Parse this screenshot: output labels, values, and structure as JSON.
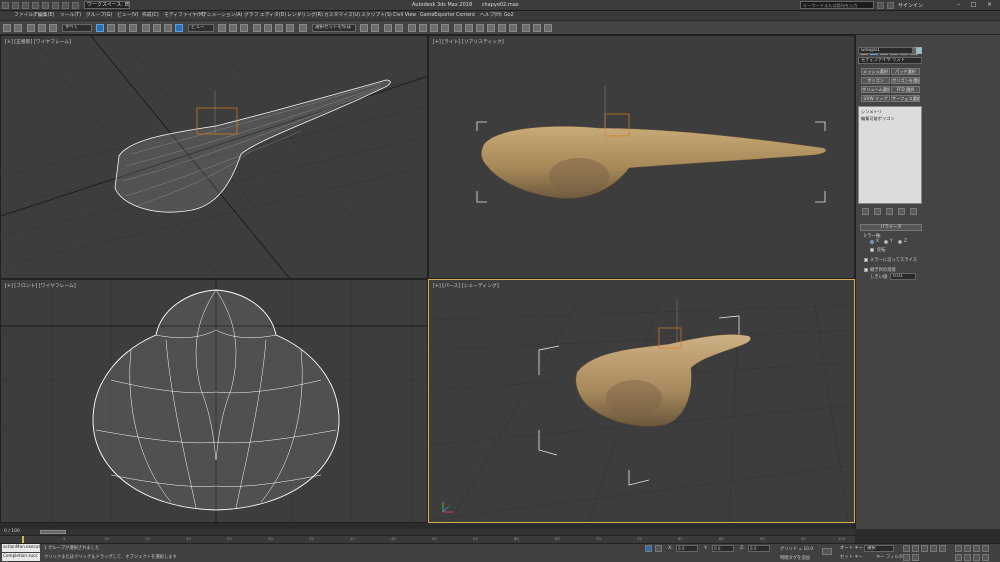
{
  "titlebar": {
    "workspace": "ワークスペース: 既定値",
    "app_title": "Autodesk 3ds Max 2018",
    "file_name": "chapyo02.max",
    "search_placeholder": "キーワードまたは語句を入力",
    "signin": "サインイン"
  },
  "menu": {
    "items": [
      "ファイル(F)",
      "編集(E)",
      "ツール(T)",
      "グループ(G)",
      "ビュー(V)",
      "作成(C)",
      "モディファイヤ(M)",
      "アニメーション(A)",
      "グラフ エディタ(D)",
      "レンダリング(R)",
      "カスタマイズ(U)",
      "スクリプト(S)",
      "Civil View",
      "GameExporter",
      "Content",
      "ヘルプ(H)",
      "Go2"
    ]
  },
  "toolbar": {
    "filter_label": "すべて",
    "coord_label": "ビュー",
    "named_selection": "選択セットを作成"
  },
  "viewports": {
    "top_left": "[+] [正投影] [ワイヤフレーム]",
    "top_right": "[+] [ライト] [リアリスティック]",
    "bottom_left": "[+] [フロント] [ワイヤフレーム]",
    "bottom_right": "[+] [パース] [シェーディング]"
  },
  "command_panel": {
    "object_name": "Group01",
    "modifier_list": "モディファイヤ リスト",
    "buttons": [
      "メッシュ選択",
      "パッチ選択",
      "ポリゴン",
      "ポリゴンを選択",
      "ボリューム選択",
      "FFD 選択",
      "UVW マップ",
      "サーフェス選択"
    ],
    "stack": [
      "シンメトリ",
      "編集可能ポリゴン"
    ],
    "rollout_title": "パラメータ",
    "mirror_axis_label": "ミラー軸:",
    "axis_x": "X",
    "axis_y": "Y",
    "axis_z": "Z",
    "flip_label": "反転",
    "slice_label": "ミラーに沿ってスライス",
    "weld_label": "継ぎ目の溶接",
    "threshold_label": "しきい値:",
    "threshold_value": "0.01"
  },
  "timeline": {
    "frame": "0 / 100",
    "ticks": [
      "0",
      "5",
      "10",
      "15",
      "20",
      "25",
      "30",
      "35",
      "40",
      "45",
      "50",
      "55",
      "60",
      "65",
      "70",
      "75",
      "80",
      "85",
      "90",
      "95",
      "100"
    ]
  },
  "status": {
    "maxscript_label": "actionMan.execut",
    "maxscript_output": "Completion succ",
    "message1": "1 グループが選択されました",
    "message2": "クリックまたはクリック＆ドラッグして、オブジェクトを選択します",
    "x_label": "X:",
    "y_label": "Y:",
    "z_label": "Z:",
    "x_value": "0.0",
    "y_value": "0.0",
    "z_value": "0.0",
    "grid": "グリッド = 10.0",
    "time_tag": "時間タグを追加",
    "autokey": "オート キー",
    "selection_set": "選択",
    "setkey": "セット キー",
    "key_filter": "キー フィルタ..."
  },
  "colors": {
    "viewport_bg": "#3d3d3d",
    "active_border": "#d6b04a",
    "wire": "#ffffff",
    "selection_bracket": "#e8e8e8",
    "pivot": "#e07b18",
    "skin": "#b89868"
  }
}
